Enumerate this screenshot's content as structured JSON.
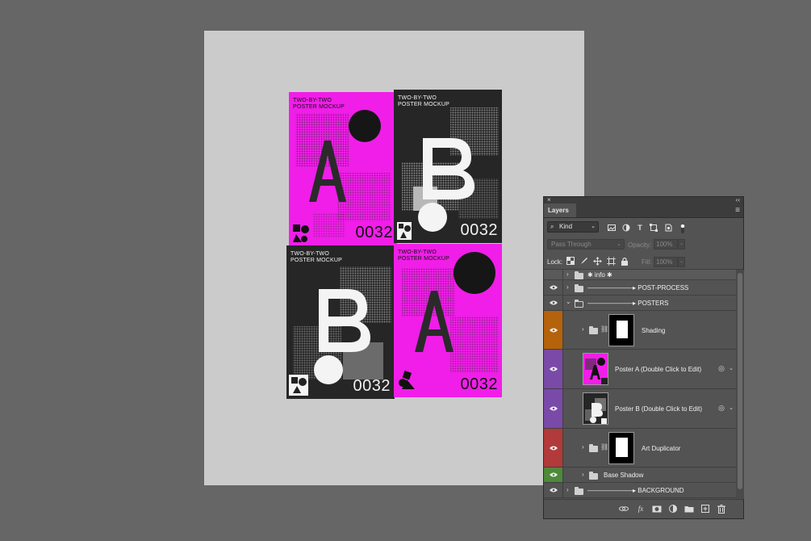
{
  "canvas": {
    "posters": [
      {
        "title_line1": "TWO-BY-TWO",
        "title_line2": "POSTER  MOCKUP",
        "letter": "A",
        "number": "0032",
        "bg": "#f01ee8"
      },
      {
        "title_line1": "TWO-BY-TWO",
        "title_line2": "POSTER  MOCKUP",
        "letter": "B",
        "number": "0032",
        "bg": "#262626"
      },
      {
        "title_line1": "TWO-BY-TWO",
        "title_line2": "POSTER  MOCKUP",
        "letter": "B",
        "number": "0032",
        "bg": "#262626"
      },
      {
        "title_line1": "TWO-BY-TWO",
        "title_line2": "POSTER  MOCKUP",
        "letter": "A",
        "number": "0032",
        "bg": "#f01ee8"
      }
    ]
  },
  "layers_panel": {
    "close_glyph": "×",
    "collapse_glyph": "‹‹",
    "tab_label": "Layers",
    "menu_glyph": "≡",
    "filter": {
      "kind_label": "Kind",
      "icons": [
        "image-filter-icon",
        "adjustment-filter-icon",
        "type-filter-icon",
        "shape-filter-icon",
        "smart-object-filter-icon",
        "filter-toggle-icon"
      ]
    },
    "blend_mode": "Pass Through",
    "opacity_label": "Opacity:",
    "opacity_value": "100%",
    "lock_label": "Lock:",
    "fill_label": "Fill:",
    "fill_value": "100%",
    "layers": [
      {
        "name": "✱ info ✱",
        "type": "group",
        "visible": false,
        "color": ""
      },
      {
        "name": "———————▸ POST-PROCESS",
        "type": "group",
        "visible": true,
        "color": ""
      },
      {
        "name": "———————▸ POSTERS",
        "type": "group-open",
        "visible": true,
        "color": ""
      },
      {
        "name": "Shading",
        "type": "group-mask",
        "visible": true,
        "color": "#b5620c"
      },
      {
        "name": "Poster A (Double Click to Edit)",
        "type": "smart-object",
        "visible": true,
        "color": "#7a4aa8"
      },
      {
        "name": "Poster B (Double Click to Edit)",
        "type": "smart-object",
        "visible": true,
        "color": "#7a4aa8"
      },
      {
        "name": "Art Duplicator",
        "type": "group-mask",
        "visible": true,
        "color": "#b23a3a"
      },
      {
        "name": "Base Shadow",
        "type": "group",
        "visible": true,
        "color": "#4d8a3a"
      },
      {
        "name": "———————▸ BACKGROUND",
        "type": "group",
        "visible": true,
        "color": ""
      }
    ],
    "footer_icons": [
      "link-layers-icon",
      "fx-icon",
      "add-mask-icon",
      "adjustment-layer-icon",
      "new-group-icon",
      "new-layer-icon",
      "trash-icon"
    ],
    "footer_fx": "fx"
  }
}
